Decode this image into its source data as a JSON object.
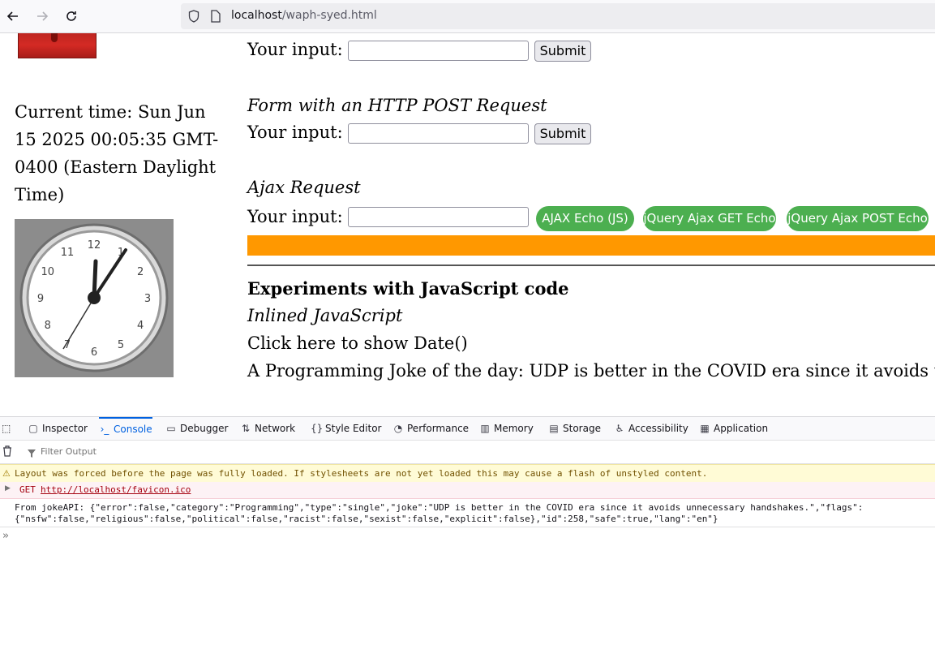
{
  "browser": {
    "url_host": "localhost",
    "url_path": "/waph-syed.html",
    "back_icon": "back-arrow-icon",
    "forward_icon": "forward-arrow-icon",
    "reload_icon": "reload-icon"
  },
  "page": {
    "left": {
      "current_time": "Current time: Sun Jun 15 2025 00:05:35 GMT-0400 (Eastern Daylight Time)"
    },
    "form_get": {
      "input_label": "Your input:",
      "submit_label": "Submit"
    },
    "form_post": {
      "heading": "Form with an HTTP POST Request",
      "input_label": "Your input:",
      "submit_label": "Submit"
    },
    "ajax": {
      "heading": "Ajax Request",
      "input_label": "Your input:",
      "btn_js": "AJAX Echo (JS)",
      "btn_get": "jQuery Ajax GET Echo",
      "btn_post": "jQuery Ajax POST Echo"
    },
    "js_section": {
      "title": "Experiments with JavaScript code",
      "inline_heading": "Inlined JavaScript",
      "show_date": "Click here to show Date()",
      "joke": "A Programming Joke of the day: UDP is better in the COVID era since it avoids unnecessary handshakes."
    },
    "clock": {
      "numbers": [
        "12",
        "1",
        "2",
        "3",
        "4",
        "5",
        "6",
        "7",
        "8",
        "9",
        "10",
        "11"
      ]
    }
  },
  "devtools": {
    "tabs": [
      {
        "label": "Inspector",
        "icon": "inspector-icon"
      },
      {
        "label": "Console",
        "icon": "console-icon"
      },
      {
        "label": "Debugger",
        "icon": "debugger-icon"
      },
      {
        "label": "Network",
        "icon": "network-icon"
      },
      {
        "label": "Style Editor",
        "icon": "style-editor-icon"
      },
      {
        "label": "Performance",
        "icon": "performance-icon"
      },
      {
        "label": "Memory",
        "icon": "memory-icon"
      },
      {
        "label": "Storage",
        "icon": "storage-icon"
      },
      {
        "label": "Accessibility",
        "icon": "accessibility-icon"
      },
      {
        "label": "Application",
        "icon": "application-icon"
      }
    ],
    "active_tab": "Console",
    "filter_placeholder": "Filter Output",
    "warning": "Layout was forced before the page was fully loaded. If stylesheets are not yet loaded this may cause a flash of unstyled content.",
    "error_method": "GET",
    "error_url": "http://localhost/favicon.ico",
    "log_line1": "From jokeAPI: {\"error\":false,\"category\":\"Programming\",\"type\":\"single\",\"joke\":\"UDP is better in the COVID era since it avoids unnecessary handshakes.\",\"flags\":",
    "log_line2": "{\"nsfw\":false,\"religious\":false,\"political\":false,\"racist\":false,\"sexist\":false,\"explicit\":false},\"id\":258,\"safe\":true,\"lang\":\"en\"}",
    "prompt_symbol": "»"
  },
  "colors": {
    "green_button": "#4caf50",
    "orange_bar": "#ff9800",
    "active_tab": "#0061e0"
  }
}
